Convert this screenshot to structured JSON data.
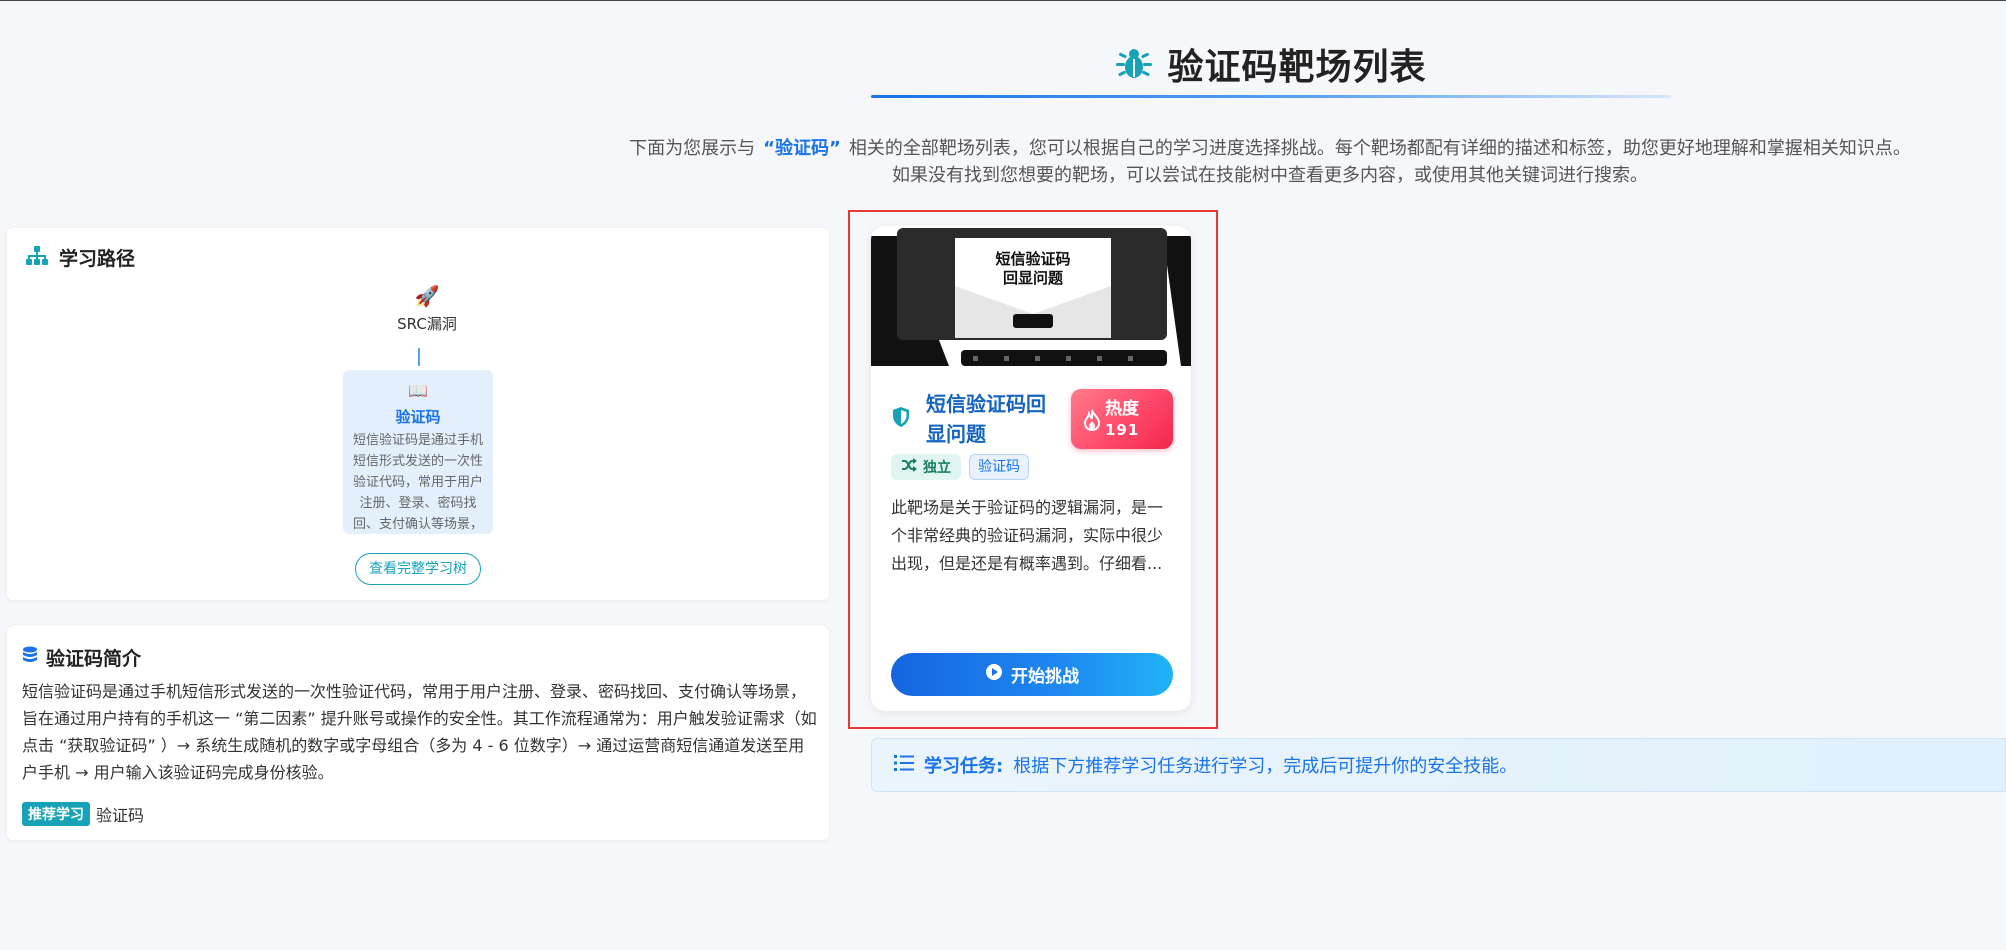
{
  "header": {
    "title": "验证码靶场列表",
    "intro_prefix": "下面为您展示与",
    "intro_keyword": "“验证码”",
    "intro_suffix": "相关的全部靶场列表，您可以根据自己的学习进度选择挑战。每个靶场都配有详细的描述和标签，助您更好地理解和掌握相关知识点。",
    "intro_line2": "如果没有找到您想要的靶场，可以尝试在技能树中查看更多内容，或使用其他关键词进行搜索。"
  },
  "learning_path": {
    "title": "学习路径",
    "root_node": {
      "icon": "rocket-icon",
      "label": "SRC漏洞"
    },
    "current_node": {
      "icon": "book-icon",
      "title": "验证码",
      "description": "短信验证码是通过手机短信形式发送的一次性验证代码，常用于用户注册、登录、密码找回、支付确认等场景，"
    },
    "view_tree_button": "查看完整学习树"
  },
  "intro_panel": {
    "title": "验证码简介",
    "body": "短信验证码是通过手机短信形式发送的一次性验证代码，常用于用户注册、登录、密码找回、支付确认等场景，旨在通过用户持有的手机这一 “第二因素” 提升账号或操作的安全性。其工作流程通常为：用户触发验证需求（如点击 “获取验证码” ）→ 系统生成随机的数字或字母组合（多为 4 - 6 位数字）→ 通过运营商短信通道发送至用户手机 → 用户输入该验证码完成身份核验。",
    "tag_label": "推荐学习",
    "tag_text": "验证码"
  },
  "card": {
    "thumbnail_title": "短信验证码\n回显问题",
    "title": "短信验证码回显问题",
    "heat_label": "热度",
    "heat_value": "191",
    "mode_tag": "独立",
    "category_tag": "验证码",
    "description": "此靶场是关于验证码的逻辑漏洞，是一个非常经典的验证码漏洞，实际中很少出现，但是还是有概率遇到。仔细看...",
    "start_button": "开始挑战"
  },
  "task": {
    "label": "学习任务:",
    "text": "根据下方推荐学习任务进行学习，完成后可提升你的安全技能。"
  },
  "colors": {
    "primary": "#1a73e8",
    "teal": "#17a2b8",
    "heat": "#f2264d",
    "frame": "#e53935"
  }
}
